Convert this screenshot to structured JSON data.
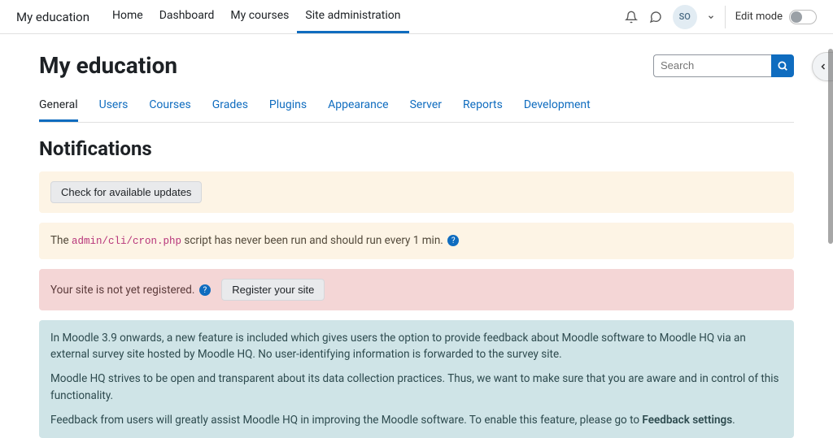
{
  "brand": "My education",
  "nav": {
    "home": "Home",
    "dashboard": "Dashboard",
    "mycourses": "My courses",
    "siteadmin": "Site administration"
  },
  "user": {
    "initials": "SO"
  },
  "editmode_label": "Edit mode",
  "page_title": "My education",
  "search_placeholder": "Search",
  "admin_tabs": {
    "general": "General",
    "users": "Users",
    "courses": "Courses",
    "grades": "Grades",
    "plugins": "Plugins",
    "appearance": "Appearance",
    "server": "Server",
    "reports": "Reports",
    "development": "Development"
  },
  "section_title": "Notifications",
  "alerts": {
    "updates_button": "Check for available updates",
    "cron_prefix": "The ",
    "cron_code": "admin/cli/cron.php",
    "cron_suffix": " script has never been run and should run every 1 min. ",
    "register_text": "Your site is not yet registered. ",
    "register_button": "Register your site",
    "feedback_p1": "In Moodle 3.9 onwards, a new feature is included which gives users the option to provide feedback about Moodle software to Moodle HQ via an external survey site hosted by Moodle HQ. No user-identifying information is forwarded to the survey site.",
    "feedback_p2": "Moodle HQ strives to be open and transparent about its data collection practices. Thus, we want to make sure that you are aware and in control of this functionality.",
    "feedback_p3_prefix": "Feedback from users will greatly assist Moodle HQ in improving the Moodle software. To enable this feature, please go to ",
    "feedback_p3_bold": "Feedback settings",
    "feedback_p3_suffix": "."
  }
}
